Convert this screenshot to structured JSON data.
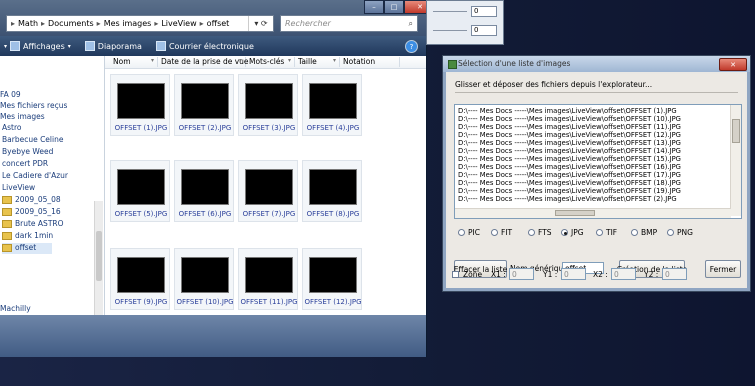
{
  "explorer": {
    "breadcrumb": [
      "Math",
      "Documents",
      "Mes images",
      "LiveView",
      "offset"
    ],
    "search_placeholder": "Rechercher",
    "toolbar": {
      "items": [
        "Affichages",
        "Diaporama",
        "Courrier électronique"
      ]
    },
    "columns": [
      "Nom",
      "Date de la prise de vue",
      "Mots-clés",
      "Taille",
      "Notation"
    ],
    "nav_items": [
      {
        "label": "FA 09",
        "folder": false
      },
      {
        "label": "Mes fichiers reçus",
        "folder": false
      },
      {
        "label": "Mes images",
        "folder": false
      },
      {
        "label": "Astro",
        "folder": false
      },
      {
        "label": "Barbecue Celine",
        "folder": false
      },
      {
        "label": "Byebye Weed",
        "folder": false
      },
      {
        "label": "concert PDR",
        "folder": false
      },
      {
        "label": "Le Cadiere d'Azur",
        "folder": false
      },
      {
        "label": "LiveView",
        "folder": false
      },
      {
        "label": "2009_05_08",
        "folder": true
      },
      {
        "label": "2009_05_16",
        "folder": true
      },
      {
        "label": "Brute ASTRO",
        "folder": true
      },
      {
        "label": "dark 1min",
        "folder": true
      },
      {
        "label": "offset",
        "folder": true,
        "selected": true
      },
      {
        "label": "Machilly",
        "folder": false
      }
    ],
    "files": [
      "OFFSET (1).JPG",
      "OFFSET (2).JPG",
      "OFFSET (3).JPG",
      "OFFSET (4).JPG",
      "OFFSET (5).JPG",
      "OFFSET (6).JPG",
      "OFFSET (7).JPG",
      "OFFSET (8).JPG",
      "OFFSET (9).JPG",
      "OFFSET (10).JPG",
      "OFFSET (11).JPG",
      "OFFSET (12).JPG"
    ]
  },
  "top_window": {
    "values": [
      "0",
      "0"
    ]
  },
  "dialog": {
    "title": "Sélection d'une liste d'images",
    "hint": "Glisser et déposer des fichiers depuis l'explorateur...",
    "list_items": [
      "D:\\---- Mes Docs -----\\Mes images\\LiveView\\offset\\OFFSET (1).JPG",
      "D:\\---- Mes Docs -----\\Mes images\\LiveView\\offset\\OFFSET (10).JPG",
      "D:\\---- Mes Docs -----\\Mes images\\LiveView\\offset\\OFFSET (11).JPG",
      "D:\\---- Mes Docs -----\\Mes images\\LiveView\\offset\\OFFSET (12).JPG",
      "D:\\---- Mes Docs -----\\Mes images\\LiveView\\offset\\OFFSET (13).JPG",
      "D:\\---- Mes Docs -----\\Mes images\\LiveView\\offset\\OFFSET (14).JPG",
      "D:\\---- Mes Docs -----\\Mes images\\LiveView\\offset\\OFFSET (15).JPG",
      "D:\\---- Mes Docs -----\\Mes images\\LiveView\\offset\\OFFSET (16).JPG",
      "D:\\---- Mes Docs -----\\Mes images\\LiveView\\offset\\OFFSET (17).JPG",
      "D:\\---- Mes Docs -----\\Mes images\\LiveView\\offset\\OFFSET (18).JPG",
      "D:\\---- Mes Docs -----\\Mes images\\LiveView\\offset\\OFFSET (19).JPG",
      "D:\\---- Mes Docs -----\\Mes images\\LiveView\\offset\\OFFSET (2).JPG"
    ],
    "formats": [
      {
        "label": "PIC",
        "checked": false
      },
      {
        "label": "FIT",
        "checked": false
      },
      {
        "label": "FTS",
        "checked": false
      },
      {
        "label": "JPG",
        "checked": true
      },
      {
        "label": "TIF",
        "checked": false
      },
      {
        "label": "BMP",
        "checked": false
      },
      {
        "label": "PNG",
        "checked": false
      }
    ],
    "clear_button": "Effacer la liste",
    "generic_name_label": "Nom générique",
    "generic_name_value": "offset",
    "create_button": "Création de la liste",
    "close_button": "Fermer",
    "zone_label": "Zone",
    "zone_fields": [
      {
        "label": "X1 :",
        "value": "0"
      },
      {
        "label": "Y1 :",
        "value": "0"
      },
      {
        "label": "X2 :",
        "value": "0"
      },
      {
        "label": "Y2 :",
        "value": "0"
      }
    ]
  }
}
